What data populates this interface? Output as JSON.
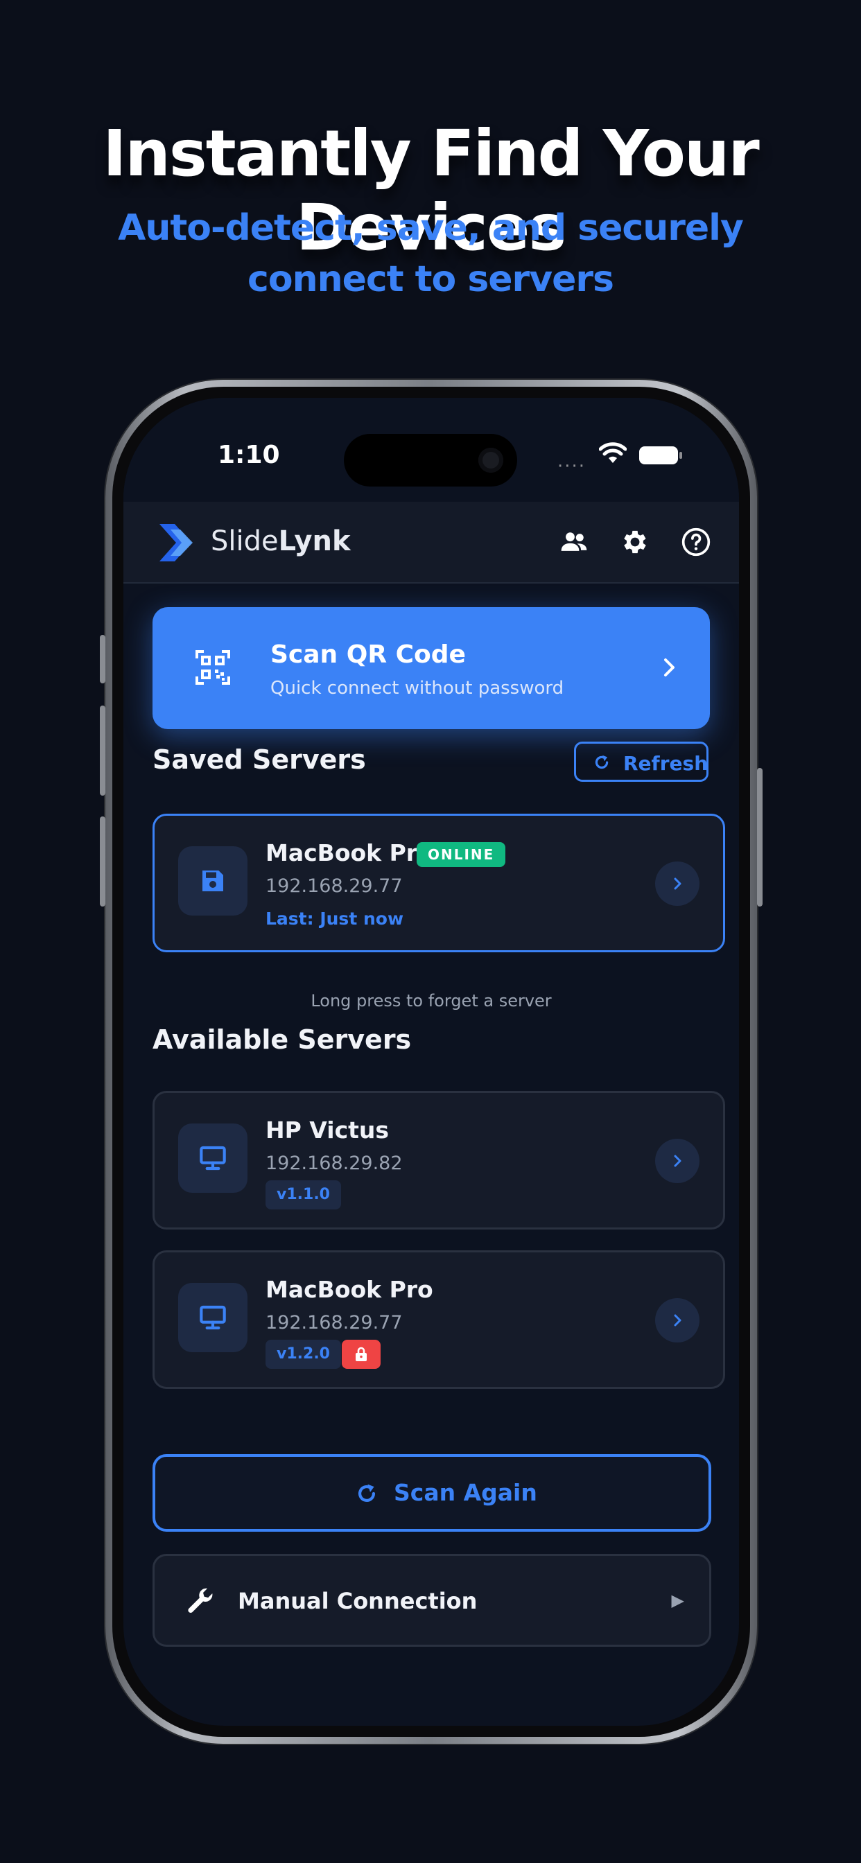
{
  "promo": {
    "headline": "Instantly Find Your Devices",
    "subline_1": "Auto-detect, save, and securely",
    "subline_2": "connect to servers"
  },
  "status_bar": {
    "time": "1:10",
    "signal": "····"
  },
  "header": {
    "brand_light": "Slide",
    "brand_bold": "Lynk",
    "icons": [
      "users-icon",
      "gear-icon",
      "help-icon"
    ]
  },
  "qr_card": {
    "title": "Scan QR Code",
    "subtitle": "Quick connect without password"
  },
  "saved": {
    "title": "Saved Servers",
    "refresh_label": "Refresh",
    "servers": [
      {
        "name": "MacBook Pro",
        "status": "ONLINE",
        "ip": "192.168.29.77",
        "last": "Last: Just now"
      }
    ],
    "hint": "Long press to forget a server"
  },
  "available": {
    "title": "Available Servers",
    "servers": [
      {
        "name": "HP Victus",
        "ip": "192.168.29.82",
        "version": "v1.1.0",
        "locked": false
      },
      {
        "name": "MacBook Pro",
        "ip": "192.168.29.77",
        "version": "v1.2.0",
        "locked": true
      }
    ]
  },
  "actions": {
    "scan_again": "Scan Again",
    "manual": "Manual Connection",
    "manual_arrow": "▶"
  },
  "colors": {
    "accent": "#3b82f6",
    "online": "#10b981",
    "lock": "#ef4444",
    "background": "#0b0f1a"
  }
}
